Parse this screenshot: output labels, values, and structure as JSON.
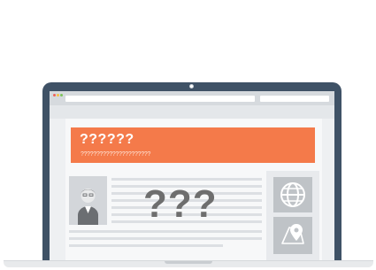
{
  "banner": {
    "title": "??????",
    "subtitle": "??????????????????????"
  },
  "content": {
    "big_question": "???"
  },
  "icons": {
    "avatar": "person-avatar-icon",
    "globe": "globe-icon",
    "map": "map-pin-icon"
  },
  "colors": {
    "banner": "#f47a4a",
    "bezel": "#3f5266",
    "traffic_red": "#f0615a",
    "traffic_yellow": "#f6c144",
    "traffic_green": "#7cc25a"
  }
}
